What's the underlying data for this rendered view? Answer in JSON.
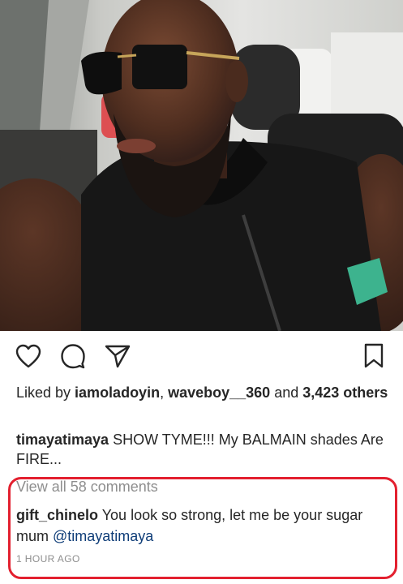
{
  "post": {
    "actions": {
      "like_icon": "heart-outline-icon",
      "comment_icon": "speech-bubble-icon",
      "share_icon": "paper-plane-icon",
      "save_icon": "bookmark-icon"
    },
    "likes": {
      "prefix": "Liked by ",
      "user1": "iamoladoyin",
      "sep": ", ",
      "user2": "waveboy__360",
      "and": " and ",
      "others": "3,423 others"
    },
    "caption": {
      "author": "timayatimaya",
      "text": " SHOW TYME!!! My BALMAIN shades Are FIRE..."
    },
    "view_all_comments": "View all 58 comments",
    "comment": {
      "author": "gift_chinelo",
      "text": " You look so strong, let me be your sugar mum ",
      "mention": "@timayatimaya"
    },
    "timestamp": "1 HOUR AGO"
  },
  "colors": {
    "highlight": "#e3202f",
    "mention": "#0f3d78",
    "muted": "#8e8e8e",
    "text": "#262626"
  }
}
